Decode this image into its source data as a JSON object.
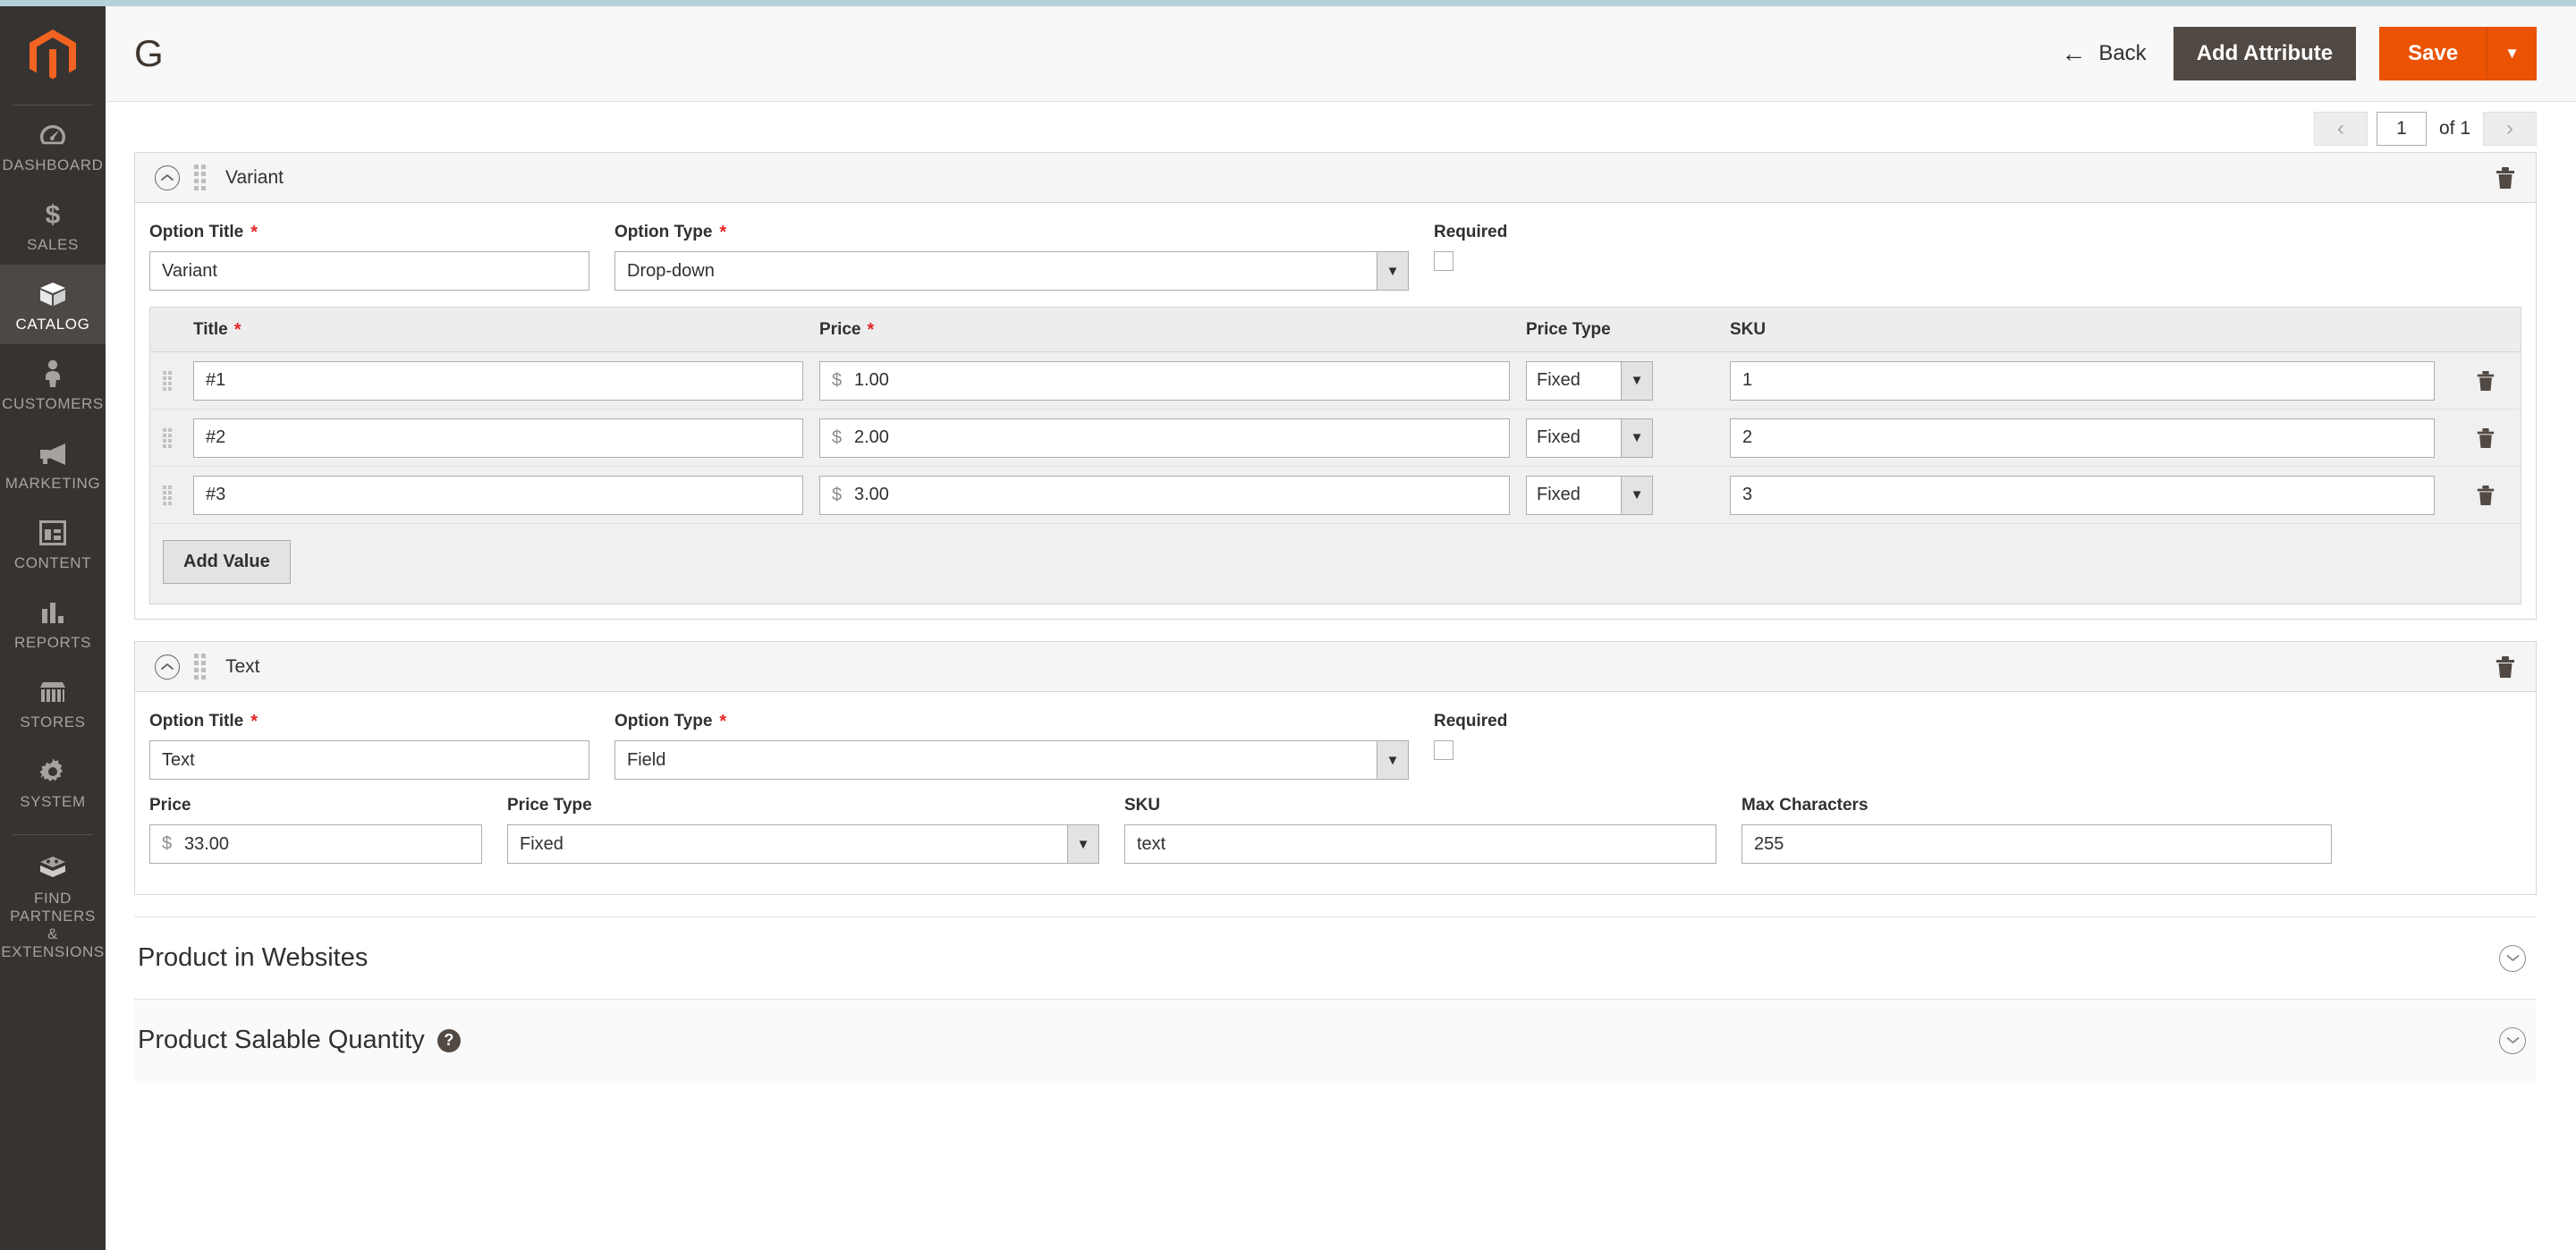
{
  "theme": {
    "accent_bar": "#b5d2d8",
    "sidebar_bg": "#373330",
    "primary": "#eb5202",
    "secondary": "#514943",
    "required_star": "#e22626"
  },
  "sidebar": {
    "logo": "magento-logo-icon",
    "items": [
      {
        "label": "DASHBOARD",
        "icon": "dashboard-icon",
        "active": false
      },
      {
        "label": "SALES",
        "icon": "dollar-icon",
        "active": false
      },
      {
        "label": "CATALOG",
        "icon": "box-icon",
        "active": true
      },
      {
        "label": "CUSTOMERS",
        "icon": "person-icon",
        "active": false
      },
      {
        "label": "MARKETING",
        "icon": "megaphone-icon",
        "active": false
      },
      {
        "label": "CONTENT",
        "icon": "layout-icon",
        "active": false
      },
      {
        "label": "REPORTS",
        "icon": "bar-chart-icon",
        "active": false
      },
      {
        "label": "STORES",
        "icon": "storefront-icon",
        "active": false
      },
      {
        "label": "SYSTEM",
        "icon": "gear-icon",
        "active": false
      },
      {
        "label": "FIND PARTNERS\n& EXTENSIONS",
        "icon": "extension-icon",
        "active": false
      }
    ],
    "find_partners_line1": "FIND PARTNERS",
    "find_partners_line2": "& EXTENSIONS"
  },
  "header": {
    "title": "G",
    "back_label": "Back",
    "add_attribute_label": "Add Attribute",
    "save_label": "Save",
    "save_caret": "▼",
    "back_arrow": "←"
  },
  "pagination": {
    "prev": "‹",
    "next": "›",
    "current_page": "1",
    "of_label": "of 1"
  },
  "sections": [
    {
      "title": "Variant",
      "option_title_label": "Option Title",
      "option_title_value": "Variant",
      "option_type_label": "Option Type",
      "option_type_value": "Drop-down",
      "required_label": "Required",
      "required_checked": false,
      "table": {
        "columns": [
          "Title",
          "Price",
          "Price Type",
          "SKU"
        ],
        "rows": [
          {
            "title": "#1",
            "price": "1.00",
            "currency": "$",
            "price_type": "Fixed",
            "sku": "1"
          },
          {
            "title": "#2",
            "price": "2.00",
            "currency": "$",
            "price_type": "Fixed",
            "sku": "2"
          },
          {
            "title": "#3",
            "price": "3.00",
            "currency": "$",
            "price_type": "Fixed",
            "sku": "3"
          }
        ],
        "add_value_label": "Add Value"
      }
    },
    {
      "title": "Text",
      "option_title_label": "Option Title",
      "option_title_value": "Text",
      "option_type_label": "Option Type",
      "option_type_value": "Field",
      "required_label": "Required",
      "required_checked": false,
      "detail_fields": {
        "price_label": "Price",
        "price_value": "33.00",
        "currency": "$",
        "price_type_label": "Price Type",
        "price_type_value": "Fixed",
        "sku_label": "SKU",
        "sku_value": "text",
        "max_chars_label": "Max Characters",
        "max_chars_value": "255"
      }
    }
  ],
  "collapsed_sections": [
    {
      "title": "Product in Websites",
      "has_help": false
    },
    {
      "title": "Product Salable Quantity",
      "has_help": true,
      "help_glyph": "?"
    }
  ]
}
